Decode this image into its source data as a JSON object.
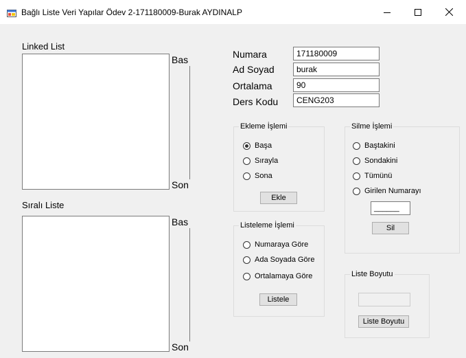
{
  "window": {
    "title": "Bağlı Liste Veri Yapılar Ödev 2-171180009-Burak AYDINALP"
  },
  "linked_list": {
    "label": "Linked List",
    "head_label": "Bas",
    "tail_label": "Son"
  },
  "sorted_list": {
    "label": "Sıralı Liste",
    "head_label": "Bas",
    "tail_label": "Son"
  },
  "fields": {
    "numara_label": "Numara",
    "numara_value": "171180009",
    "adsoyad_label": "Ad Soyad",
    "adsoyad_value": "burak",
    "ortalama_label": "Ortalama",
    "ortalama_value": "90",
    "derskodu_label": "Ders Kodu",
    "derskodu_value": "CENG203"
  },
  "ekleme": {
    "title": "Ekleme İşlemi",
    "options": [
      "Başa",
      "Sırayla",
      "Sona"
    ],
    "selected": "Başa",
    "button": "Ekle"
  },
  "silme": {
    "title": "Silme İşlemi",
    "options": [
      "Baştakini",
      "Sondakini",
      "Tümünü",
      "Girilen Numarayı"
    ],
    "input_value": "______",
    "button": "Sil"
  },
  "listeleme": {
    "title": "Listeleme İşlemi",
    "options": [
      "Numaraya Göre",
      "Ada Soyada Göre",
      "Ortalamaya Göre"
    ],
    "button": "Listele"
  },
  "liste_boyutu": {
    "title": "Liste Boyutu",
    "button": "Liste Boyutu"
  }
}
